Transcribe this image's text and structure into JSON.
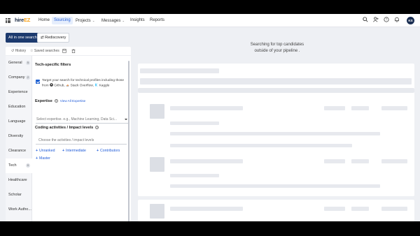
{
  "topnav": {
    "logo_main": "hire",
    "logo_accent": "EZ",
    "items": [
      {
        "label": "Home",
        "caret": ""
      },
      {
        "label": "Sourcing",
        "caret": ""
      },
      {
        "label": "Projects",
        "caret": "⌄"
      },
      {
        "label": "Messages",
        "caret": "⌄"
      },
      {
        "label": "Insights",
        "caret": ""
      },
      {
        "label": "Reports",
        "caret": ""
      }
    ],
    "active_item": "Sourcing",
    "icons": [
      "search-icon",
      "people-icon",
      "help-icon",
      "bell-icon"
    ],
    "avatar_initials": "KS"
  },
  "modes": {
    "primary": "All in one search",
    "secondary": "Rediscovery",
    "secondary_icon": "⇄"
  },
  "tools": {
    "history": "History",
    "saved": "Saved searches",
    "history_icon": "↺",
    "saved_icon": "☆"
  },
  "sidebar": {
    "items": [
      {
        "label": "General",
        "badge": "5"
      },
      {
        "label": "Company",
        "badge": "2"
      },
      {
        "label": "Experience",
        "badge": ""
      },
      {
        "label": "Education",
        "badge": ""
      },
      {
        "label": "Language",
        "badge": ""
      },
      {
        "label": "Diversity",
        "badge": ""
      },
      {
        "label": "Clearance",
        "badge": ""
      },
      {
        "label": "Tech",
        "badge": "0"
      },
      {
        "label": "Healthcare",
        "badge": ""
      },
      {
        "label": "Scholar",
        "badge": ""
      },
      {
        "label": "Work Autho...",
        "badge": ""
      }
    ],
    "active": "Tech"
  },
  "tech": {
    "title": "Tech-specific filters",
    "checkbox_text_1": "Target your search for technical profiles including those",
    "checkbox_text_2_prefix": "from",
    "sources": [
      "Github,",
      "Stack Overflow,",
      "Kaggle"
    ],
    "checked": true,
    "expertise_label": "Expertise",
    "expertise_link": "View All Expertise",
    "expertise_placeholder": "Select expertise. e.g., Machine Learning, Data Sci...",
    "coding_label": "Coding activities / Impact levels",
    "coding_placeholder": "Choose the activities / impact levels",
    "chips": [
      "Unranked",
      "Intermediate",
      "Contributors",
      "Master"
    ]
  },
  "main": {
    "message_line1": "Searching for top candidates",
    "message_line2": "outside of your pipeline ."
  },
  "colors": {
    "brand_navy": "#1c3a6e",
    "accent_blue": "#1f5bd8",
    "logo_orange": "#f7a21b"
  }
}
